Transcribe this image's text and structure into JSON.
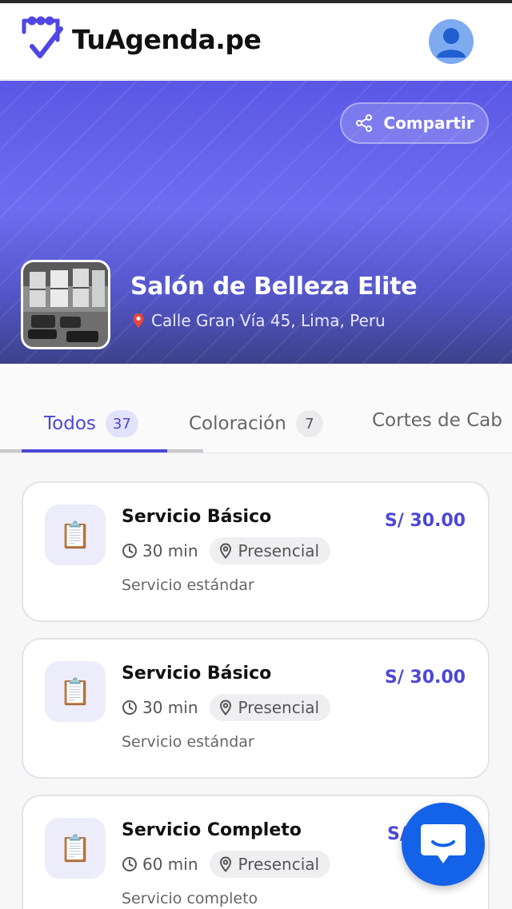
{
  "brand": {
    "name": "TuAgenda.pe"
  },
  "header": {
    "avatar_icon": "user-avatar-icon"
  },
  "hero": {
    "share_label": "Compartir",
    "salon_name": "Salón de Belleza Elite",
    "address": "Calle Gran Vía 45, Lima, Peru"
  },
  "tabs": [
    {
      "label": "Todos",
      "count": "37",
      "active": true
    },
    {
      "label": "Coloración",
      "count": "7",
      "active": false
    },
    {
      "label": "Cortes de Cab",
      "count": "",
      "active": false
    }
  ],
  "services": [
    {
      "title": "Servicio Básico",
      "price": "S/ 30.00",
      "duration": "30 min",
      "mode": "Presencial",
      "description": "Servicio estándar"
    },
    {
      "title": "Servicio Básico",
      "price": "S/ 30.00",
      "duration": "30 min",
      "mode": "Presencial",
      "description": "Servicio estándar"
    },
    {
      "title": "Servicio Completo",
      "price": "S/",
      "duration": "60 min",
      "mode": "Presencial",
      "description": "Servicio completo"
    }
  ],
  "colors": {
    "accent": "#4b47d6",
    "chat": "#1462e8",
    "hero_top": "#5b57e6"
  }
}
